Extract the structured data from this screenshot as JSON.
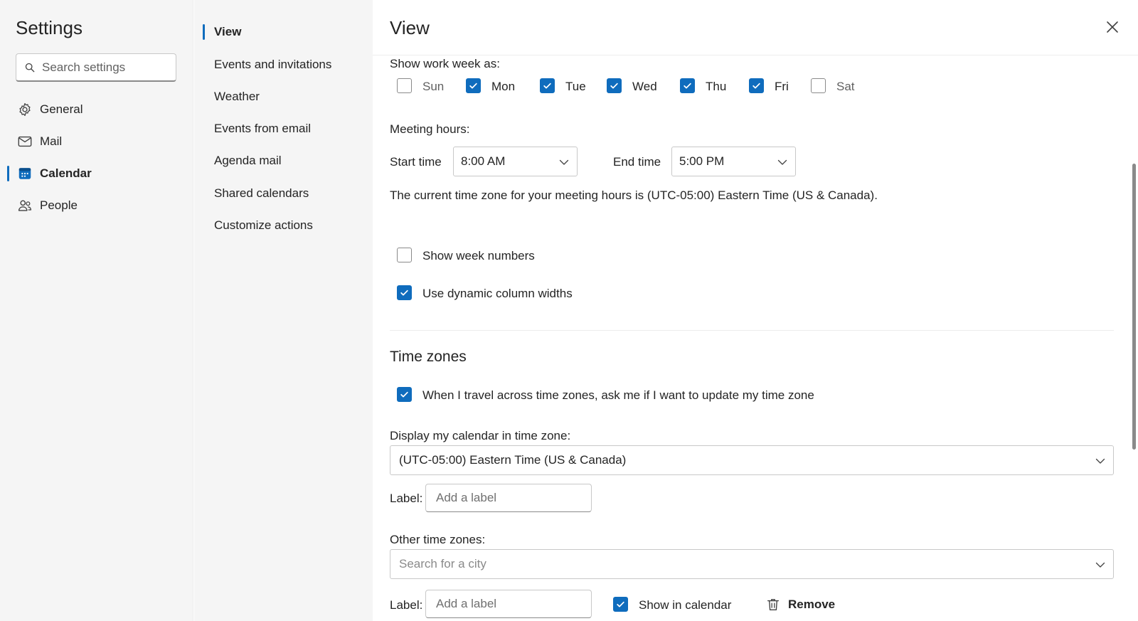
{
  "settings": {
    "title": "Settings",
    "search_placeholder": "Search settings",
    "nav": [
      {
        "label": "General",
        "icon": "gear-icon"
      },
      {
        "label": "Mail",
        "icon": "mail-icon"
      },
      {
        "label": "Calendar",
        "icon": "calendar-icon",
        "active": true
      },
      {
        "label": "People",
        "icon": "people-icon"
      }
    ]
  },
  "subnav": [
    {
      "label": "View",
      "active": true
    },
    {
      "label": "Events and invitations"
    },
    {
      "label": "Weather"
    },
    {
      "label": "Events from email"
    },
    {
      "label": "Agenda mail"
    },
    {
      "label": "Shared calendars"
    },
    {
      "label": "Customize actions"
    }
  ],
  "main": {
    "title": "View",
    "work_week": {
      "label": "Show work week as:",
      "days": [
        {
          "label": "Sun",
          "checked": false
        },
        {
          "label": "Mon",
          "checked": true
        },
        {
          "label": "Tue",
          "checked": true
        },
        {
          "label": "Wed",
          "checked": true
        },
        {
          "label": "Thu",
          "checked": true
        },
        {
          "label": "Fri",
          "checked": true
        },
        {
          "label": "Sat",
          "checked": false
        }
      ]
    },
    "meeting_hours": {
      "label": "Meeting hours:",
      "start_label": "Start time",
      "start_value": "8:00 AM",
      "end_label": "End time",
      "end_value": "5:00 PM",
      "timezone_note": "The current time zone for your meeting hours is (UTC-05:00) Eastern Time (US & Canada)."
    },
    "options": {
      "show_week_numbers": {
        "label": "Show week numbers",
        "checked": false
      },
      "dynamic_columns": {
        "label": "Use dynamic column widths",
        "checked": true
      }
    },
    "time_zones": {
      "title": "Time zones",
      "travel_prompt": {
        "label": "When I travel across time zones, ask me if I want to update my time zone",
        "checked": true
      },
      "display_label": "Display my calendar in time zone:",
      "display_value": "(UTC-05:00) Eastern Time (US & Canada)",
      "label_text": "Label:",
      "label_placeholder": "Add a label",
      "other_label": "Other time zones:",
      "city_placeholder": "Search for a city",
      "other_label_text": "Label:",
      "other_label_placeholder": "Add a label",
      "show_in_calendar": {
        "label": "Show in calendar",
        "checked": true
      },
      "remove_label": "Remove"
    }
  },
  "colors": {
    "accent": "#0f6cbd",
    "nav_background": "#f5f5f5",
    "text": "#242424"
  }
}
